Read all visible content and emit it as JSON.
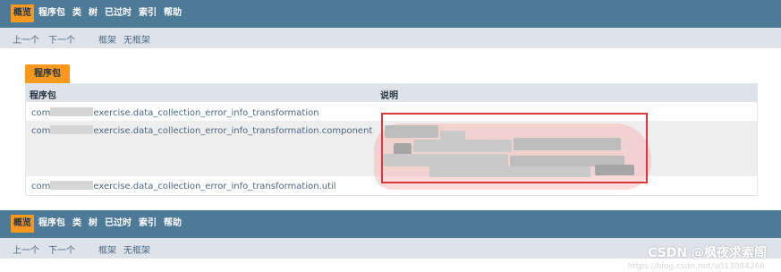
{
  "nav": {
    "items": [
      {
        "label": "概览",
        "active": true
      },
      {
        "label": "程序包",
        "active": false
      },
      {
        "label": "类",
        "active": false
      },
      {
        "label": "树",
        "active": false
      },
      {
        "label": "已过时",
        "active": false
      },
      {
        "label": "索引",
        "active": false
      },
      {
        "label": "帮助",
        "active": false
      }
    ]
  },
  "subnav": {
    "prev": "上一个",
    "next": "下一个",
    "frames": "框架",
    "no_frames": "无框架"
  },
  "packages_tab": "程序包",
  "table": {
    "headers": [
      "程序包",
      "说明"
    ],
    "rows": [
      {
        "prefix": "com",
        "suffix": "exercise.data_collection_error_info_transformation"
      },
      {
        "prefix": "com",
        "suffix": "exercise.data_collection_error_info_transformation.component"
      },
      {
        "prefix": "com",
        "suffix": "exercise.data_collection_error_info_transformation.util"
      }
    ]
  },
  "watermark": "CSDN @枫夜求索阁",
  "watermark_url": "https://blog.csdn.net/u013084266"
}
